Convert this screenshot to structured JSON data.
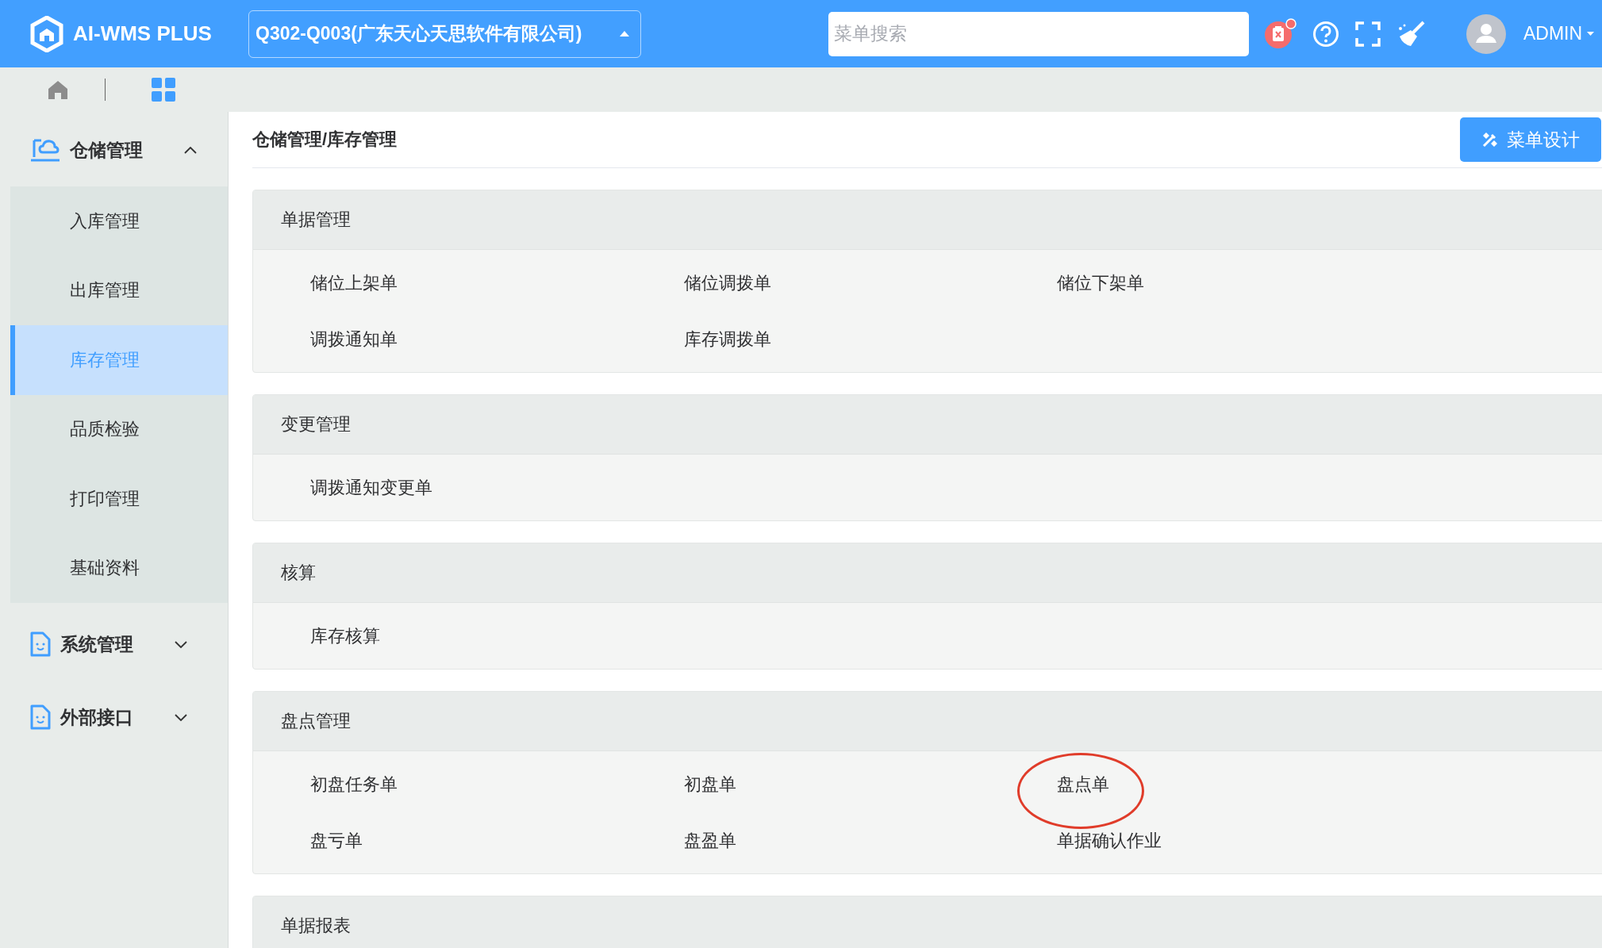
{
  "header": {
    "logo_text": "AI-WMS PLUS",
    "company": "Q302-Q003(广东天心天思软件有限公司)",
    "search": {
      "placeholder": "菜单搜索"
    },
    "user": "ADMIN"
  },
  "sidebar": {
    "groups": [
      {
        "label": "仓储管理",
        "kind": "cloud",
        "expanded": true,
        "children": [
          {
            "label": "入库管理",
            "selected": false
          },
          {
            "label": "出库管理",
            "selected": false
          },
          {
            "label": "库存管理",
            "selected": true
          },
          {
            "label": "品质检验",
            "selected": false
          },
          {
            "label": "打印管理",
            "selected": false
          },
          {
            "label": "基础资料",
            "selected": false
          }
        ]
      },
      {
        "label": "系统管理",
        "kind": "doc",
        "expanded": false
      },
      {
        "label": "外部接口",
        "kind": "doc",
        "expanded": false
      }
    ]
  },
  "content": {
    "breadcrumb": "仓储管理/库存管理",
    "design_button": "菜单设计",
    "sections": [
      {
        "title": "单据管理",
        "items": [
          {
            "label": "储位上架单",
            "circled": false
          },
          {
            "label": "储位调拨单",
            "circled": false
          },
          {
            "label": "储位下架单",
            "circled": false
          },
          {
            "label": "调拨通知单",
            "circled": false
          },
          {
            "label": "库存调拨单",
            "circled": false
          }
        ]
      },
      {
        "title": "变更管理",
        "items": [
          {
            "label": "调拨通知变更单",
            "circled": false
          }
        ]
      },
      {
        "title": "核算",
        "items": [
          {
            "label": "库存核算",
            "circled": false
          }
        ]
      },
      {
        "title": "盘点管理",
        "items": [
          {
            "label": "初盘任务单",
            "circled": false
          },
          {
            "label": "初盘单",
            "circled": false
          },
          {
            "label": "盘点单",
            "circled": true
          },
          {
            "label": "盘亏单",
            "circled": false
          },
          {
            "label": "盘盈单",
            "circled": false
          },
          {
            "label": "单据确认作业",
            "circled": false
          }
        ]
      },
      {
        "title": "单据报表"
      }
    ]
  }
}
